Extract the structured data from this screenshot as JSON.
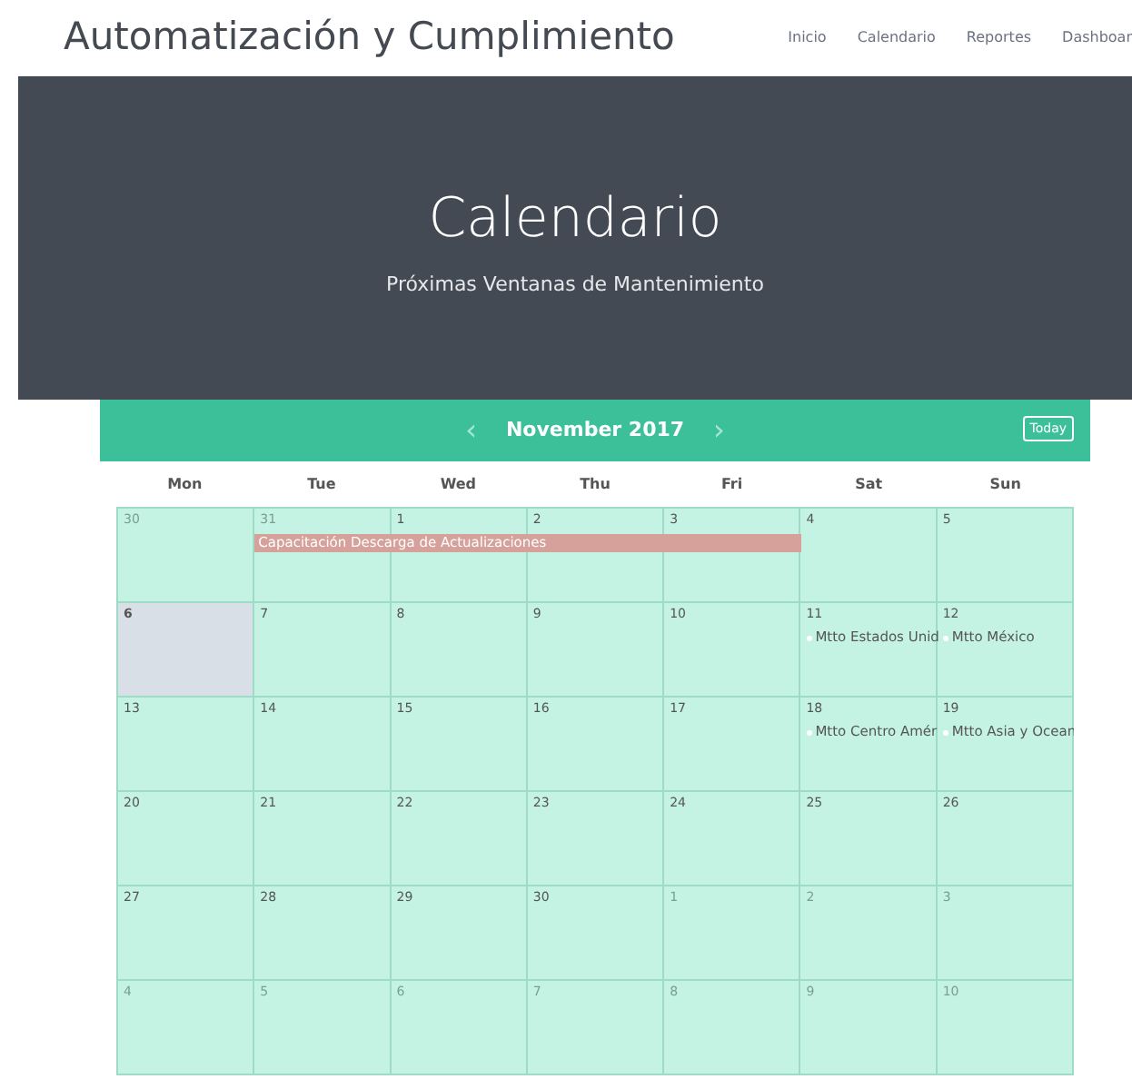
{
  "site_title": "Automatización y Cumplimiento",
  "nav": [
    {
      "label": "Inicio",
      "selected": false
    },
    {
      "label": "Calendario",
      "selected": false
    },
    {
      "label": "Reportes",
      "selected": false
    },
    {
      "label": "Dashboar",
      "selected": false
    }
  ],
  "hero": {
    "title": "Calendario",
    "subtitle": "Próximas Ventanas de Mantenimiento"
  },
  "calendar": {
    "prev": "‹",
    "month": "November 2017",
    "next": "›",
    "today_button": "Today",
    "weekdays": [
      "Mon",
      "Tue",
      "Wed",
      "Thu",
      "Fri",
      "Sat",
      "Sun"
    ],
    "weeks": [
      {
        "banner": "Capacitación Descarga de Actualizaciones",
        "days": [
          {
            "day": "30",
            "other_month": true,
            "today": false
          },
          {
            "day": "31",
            "other_month": true,
            "today": false,
            "in_banner": true
          },
          {
            "day": "1",
            "other_month": false,
            "today": false,
            "in_banner": true
          },
          {
            "day": "2",
            "other_month": false,
            "today": false,
            "in_banner": true
          },
          {
            "day": "3",
            "other_month": false,
            "today": false,
            "in_banner": true
          },
          {
            "day": "4",
            "other_month": false,
            "today": false
          },
          {
            "day": "5",
            "other_month": false,
            "today": false
          }
        ]
      },
      {
        "days": [
          {
            "day": "6",
            "other_month": false,
            "today": true
          },
          {
            "day": "7",
            "other_month": false,
            "today": false
          },
          {
            "day": "8",
            "other_month": false,
            "today": false
          },
          {
            "day": "9",
            "other_month": false,
            "today": false
          },
          {
            "day": "10",
            "other_month": false,
            "today": false
          },
          {
            "day": "11",
            "other_month": false,
            "today": false,
            "events": [
              "Mtto Estados Unid"
            ]
          },
          {
            "day": "12",
            "other_month": false,
            "today": false,
            "events": [
              "Mtto México"
            ]
          }
        ]
      },
      {
        "days": [
          {
            "day": "13",
            "other_month": false,
            "today": false
          },
          {
            "day": "14",
            "other_month": false,
            "today": false
          },
          {
            "day": "15",
            "other_month": false,
            "today": false
          },
          {
            "day": "16",
            "other_month": false,
            "today": false
          },
          {
            "day": "17",
            "other_month": false,
            "today": false
          },
          {
            "day": "18",
            "other_month": false,
            "today": false,
            "events": [
              "Mtto Centro Amér"
            ]
          },
          {
            "day": "19",
            "other_month": false,
            "today": false,
            "events": [
              "Mtto Asia y Ocean"
            ]
          }
        ]
      },
      {
        "days": [
          {
            "day": "20",
            "other_month": false,
            "today": false
          },
          {
            "day": "21",
            "other_month": false,
            "today": false
          },
          {
            "day": "22",
            "other_month": false,
            "today": false
          },
          {
            "day": "23",
            "other_month": false,
            "today": false
          },
          {
            "day": "24",
            "other_month": false,
            "today": false
          },
          {
            "day": "25",
            "other_month": false,
            "today": false
          },
          {
            "day": "26",
            "other_month": false,
            "today": false
          }
        ]
      },
      {
        "days": [
          {
            "day": "27",
            "other_month": false,
            "today": false
          },
          {
            "day": "28",
            "other_month": false,
            "today": false
          },
          {
            "day": "29",
            "other_month": false,
            "today": false
          },
          {
            "day": "30",
            "other_month": false,
            "today": false
          },
          {
            "day": "1",
            "other_month": true,
            "today": false
          },
          {
            "day": "2",
            "other_month": true,
            "today": false
          },
          {
            "day": "3",
            "other_month": true,
            "today": false
          }
        ]
      },
      {
        "days": [
          {
            "day": "4",
            "other_month": true,
            "today": false
          },
          {
            "day": "5",
            "other_month": true,
            "today": false
          },
          {
            "day": "6",
            "other_month": true,
            "today": false
          },
          {
            "day": "7",
            "other_month": true,
            "today": false
          },
          {
            "day": "8",
            "other_month": true,
            "today": false
          },
          {
            "day": "9",
            "other_month": true,
            "today": false
          },
          {
            "day": "10",
            "other_month": true,
            "today": false
          }
        ]
      }
    ]
  }
}
